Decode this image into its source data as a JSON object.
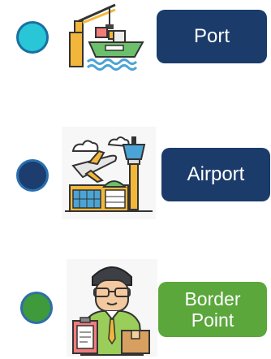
{
  "items": [
    {
      "label": "Port",
      "dot_color": "#29C6D8",
      "dot_border": "#1A6FA0",
      "button_color": "#1B3C6B",
      "icon": "port-crane-ship-icon"
    },
    {
      "label": "Airport",
      "dot_color": "#1C3D6E",
      "dot_border": "#2A6FB0",
      "button_color": "#1B3C6B",
      "icon": "airport-plane-tower-icon"
    },
    {
      "label_line1": "Border",
      "label_line2": "Point",
      "dot_color": "#3E9A3A",
      "dot_border": "#2E6FA8",
      "button_color": "#5BA73C",
      "icon": "border-officer-icon"
    }
  ]
}
